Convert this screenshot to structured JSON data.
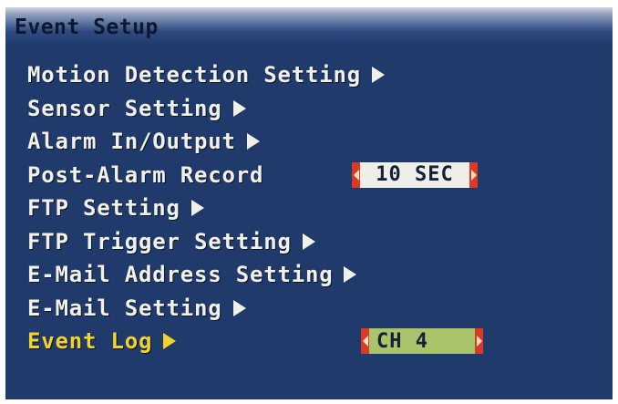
{
  "window": {
    "title": "Event Setup"
  },
  "menu": {
    "items": [
      {
        "label": "Motion Detection Setting"
      },
      {
        "label": "Sensor Setting"
      },
      {
        "label": "Alarm In/Output"
      },
      {
        "label": "Post-Alarm Record",
        "value": "10 SEC"
      },
      {
        "label": "FTP Setting"
      },
      {
        "label": "FTP Trigger Setting"
      },
      {
        "label": "E-Mail Address Setting"
      },
      {
        "label": "E-Mail Setting"
      },
      {
        "label": "Event Log",
        "value": "CH 4",
        "selected": true
      }
    ]
  },
  "colors": {
    "background": "#1f3a6b",
    "text": "#f1f1ea",
    "selected_text": "#f2d32e",
    "value_box_cap": "#d83a2a",
    "value_box_time": "#efefea",
    "value_box_channel": "#a9c46b"
  },
  "icons": {
    "submenu": "right-triangle-icon",
    "value_left": "left-triangle-icon",
    "value_right": "right-triangle-icon"
  }
}
